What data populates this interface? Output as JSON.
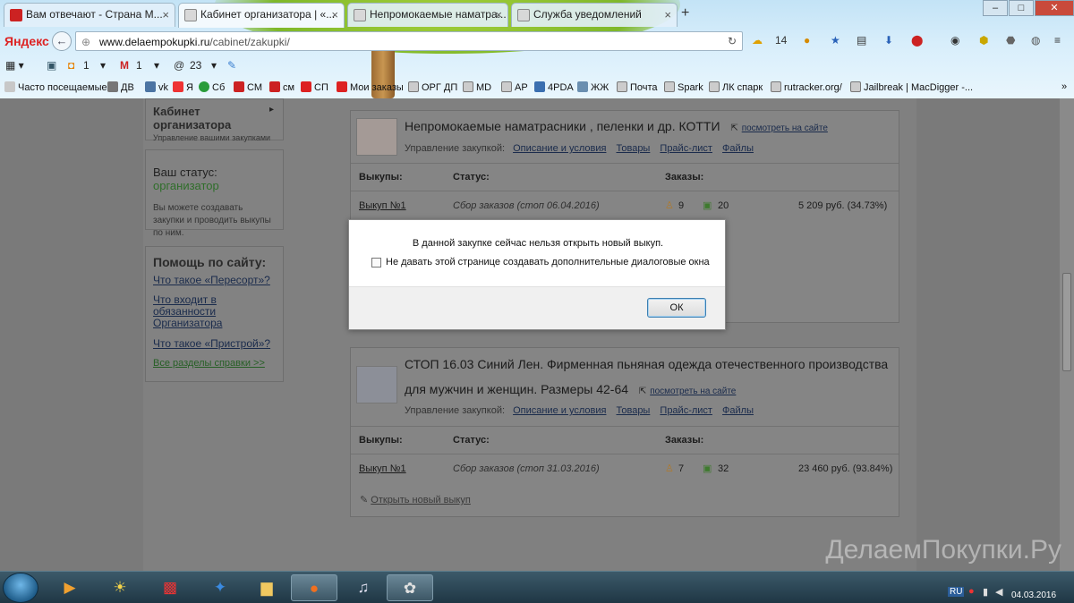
{
  "browser": {
    "tabs": [
      {
        "label": "Вам отвечают - Страна М..."
      },
      {
        "label": "Кабинет организатора | «..."
      },
      {
        "label": "Непромокаемые наматра..."
      },
      {
        "label": "Служба уведомлений"
      }
    ],
    "brand": "Яндекс",
    "url_domain": "www.delaempokupki.ru",
    "url_path": "/cabinet/zakupki/",
    "weather": "14",
    "toolbar": {
      "ok_count": "1",
      "mail_count": "1",
      "at_count": "23"
    },
    "bookmarks": [
      "Часто посещаемые",
      "ДВ",
      "vk",
      "Я",
      "Сб",
      "СМ",
      "см",
      "СП",
      "Мои заказы",
      "ОРГ ДП",
      "MD",
      "АР",
      "4PDA",
      "ЖЖ",
      "Почта",
      "Spark",
      "ЛК спарк",
      "rutracker.org/",
      "Jailbreak | MacDigger -..."
    ]
  },
  "sidebar": {
    "cabinet_title": "Кабинет организатора",
    "cabinet_sub": "Управление вашими закупками",
    "status_label": "Ваш статус:",
    "status_value": "организатор",
    "status_desc": "Вы можете создавать закупки и проводить выкупы по ним.",
    "help_title": "Помощь по сайту:",
    "help_links": [
      "Что такое «Пересорт»?",
      "Что входит в обязанности Организатора",
      "Что такое «Пристрой»?"
    ],
    "help_all": "Все разделы справки >>"
  },
  "purchases": [
    {
      "title": "Непромокаемые наматрасники , пеленки и др. КОТТИ",
      "view_link": "посмотреть на сайте",
      "manage_label": "Управление закупкой:",
      "manage_links": [
        "Описание и условия",
        "Товары",
        "Прайс-лист",
        "Файлы"
      ],
      "col_buyouts": "Выкупы:",
      "col_status": "Статус:",
      "col_orders": "Заказы:",
      "buyout_link": "Выкуп №1",
      "buyout_status": "Сбор заказов (стоп 06.04.2016)",
      "people": "9",
      "items": "20",
      "amount": "5 209 руб. (34.73%)"
    },
    {
      "title_line1": "СТОП 16.03 Синий Лен. Фирменная пьняная одежда отечественного производства",
      "title_line2": "для мужчин и женщин. Размеры 42-64",
      "view_link": "посмотреть на сайте",
      "manage_label": "Управление закупкой:",
      "manage_links": [
        "Описание и условия",
        "Товары",
        "Прайс-лист",
        "Файлы"
      ],
      "col_buyouts": "Выкупы:",
      "col_status": "Статус:",
      "col_orders": "Заказы:",
      "buyout_link": "Выкуп №1",
      "buyout_status": "Сбор заказов (стоп 31.03.2016)",
      "people": "7",
      "items": "32",
      "amount": "23 460 руб. (93.84%)",
      "open_new": "Открыть новый выкуп"
    }
  ],
  "dialog": {
    "message": "В данной закупке сейчас нельзя открыть новый выкуп.",
    "checkbox_label": "Не давать этой странице создавать дополнительные диалоговые окна",
    "ok_label": "ОК"
  },
  "watermark": "ДелаемПокупки.Ру",
  "taskbar": {
    "lang": "RU",
    "date": "04.03.2016"
  }
}
